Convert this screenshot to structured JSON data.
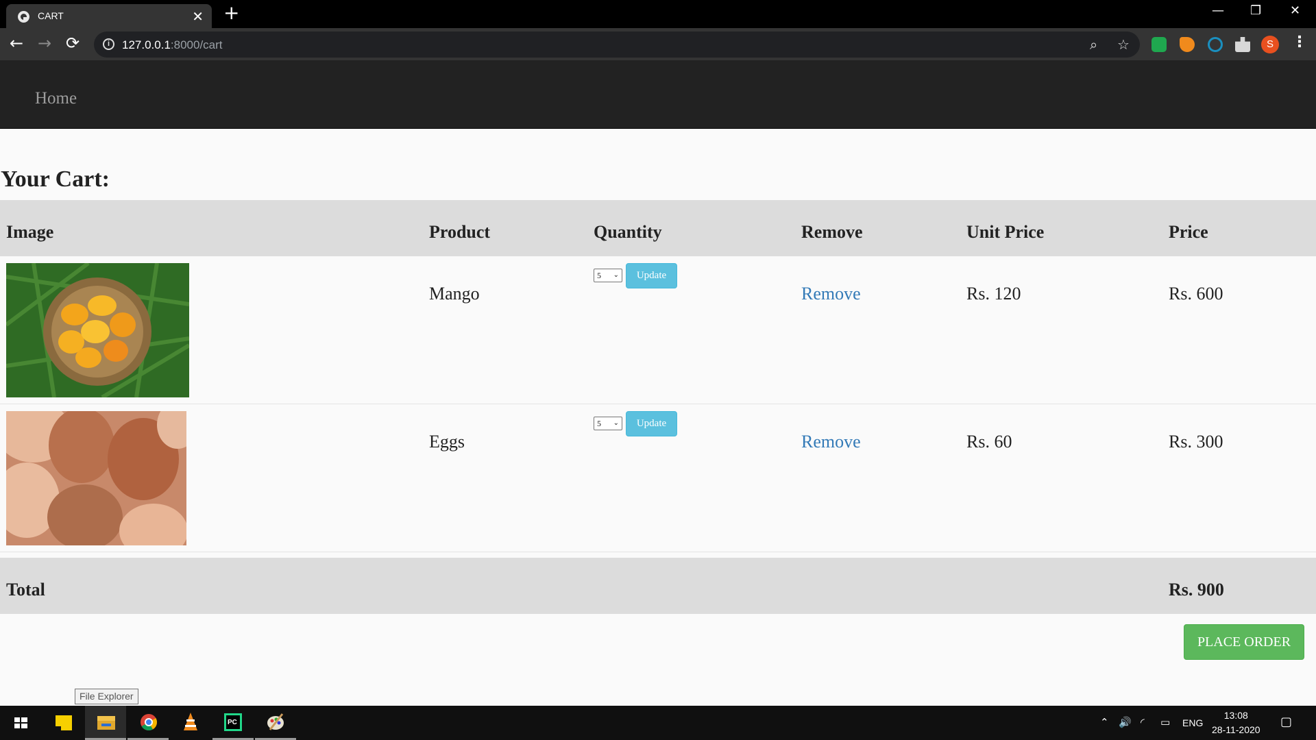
{
  "browser": {
    "tab_title": "CART",
    "tab_close": "✕",
    "new_tab": "+",
    "url_host": "127.0.0.1",
    "url_path": ":8000/cart",
    "back": "←",
    "forward": "→",
    "reload": "⟳",
    "minimize": "—",
    "restore": "❐",
    "close": "✕",
    "profile_initial": "S",
    "menu": "⋮",
    "zoom_icon": "⌕",
    "star_icon": "☆"
  },
  "navbar": {
    "home": "Home"
  },
  "page": {
    "heading": "Your Cart:"
  },
  "table": {
    "headers": {
      "image": "Image",
      "product": "Product",
      "quantity": "Quantity",
      "remove": "Remove",
      "unit_price": "Unit Price",
      "price": "Price"
    },
    "items": [
      {
        "image": "mango-basket",
        "product": "Mango",
        "quantity": "5",
        "update": "Update",
        "remove": "Remove",
        "unit_price": "Rs. 120",
        "price": "Rs. 600"
      },
      {
        "image": "eggs",
        "product": "Eggs",
        "quantity": "5",
        "update": "Update",
        "remove": "Remove",
        "unit_price": "Rs. 60",
        "price": "Rs. 300"
      }
    ],
    "total_label": "Total",
    "total_value": "Rs. 900"
  },
  "place_order": "PLACE ORDER",
  "tooltip": "File Explorer",
  "taskbar": {
    "lang": "ENG",
    "time": "13:08",
    "date": "28-11-2020",
    "icons": [
      "windows-start-icon",
      "sticky-notes-icon",
      "file-explorer-icon",
      "chrome-icon",
      "vlc-icon",
      "pycharm-icon",
      "paint-icon"
    ]
  },
  "colors": {
    "navbar": "#222222",
    "link": "#337ab7",
    "update_btn": "#5bc0de",
    "order_btn": "#5cb85c",
    "table_band": "#dcdcdc"
  }
}
